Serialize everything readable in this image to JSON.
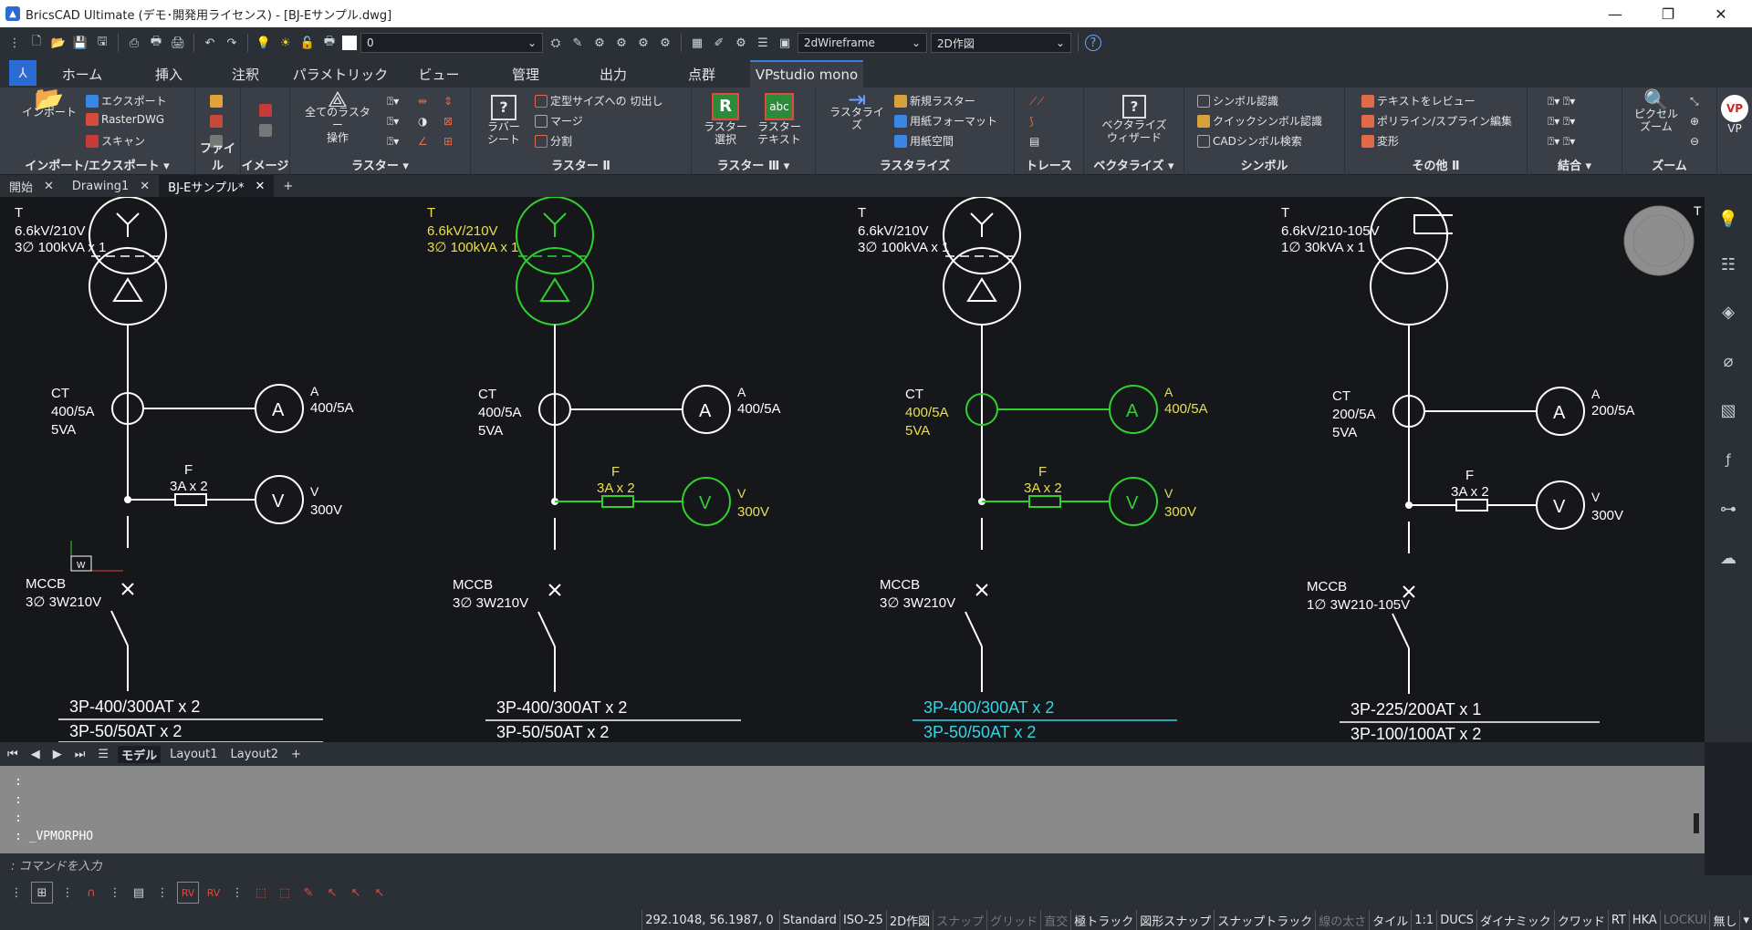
{
  "window": {
    "title": "BricsCAD Ultimate (デモ･開発用ライセンス) - [BJ-Eサンプル.dwg]",
    "app_icon": "bricscad-logo"
  },
  "qat": {
    "layer_value": "0",
    "visual_style": "2dWireframe",
    "workspace": "2D作図"
  },
  "ribbon_tabs": [
    {
      "label": "ホーム"
    },
    {
      "label": "挿入"
    },
    {
      "label": "注釈"
    },
    {
      "label": "パラメトリック"
    },
    {
      "label": "ビュー"
    },
    {
      "label": "管理"
    },
    {
      "label": "出力"
    },
    {
      "label": "点群"
    },
    {
      "label": "VPstudio mono"
    }
  ],
  "ribbon": {
    "import_export": {
      "import": "インポート",
      "export": "エクスポート",
      "rasterdwg": "RasterDWG",
      "scan": "スキャン",
      "title": "インポート/エクスポート"
    },
    "file": {
      "title": "ファイル"
    },
    "image": {
      "title": "イメージ"
    },
    "raster": {
      "all_ops": "全てのラスター\n操作",
      "title": "ラスター"
    },
    "raster2": {
      "rubber": "ラバー\nシート",
      "crop": "定型サイズへの 切出し",
      "merge": "マージ",
      "split": "分割",
      "title": "ラスター Ⅱ"
    },
    "raster3": {
      "select": "ラスター\n選択",
      "text": "ラスター\nテキスト",
      "title": "ラスター Ⅲ",
      "icon_r": "R",
      "icon_abc": "abc"
    },
    "rasterize": {
      "rasterize": "ラスタライズ",
      "new_raster": "新規ラスター",
      "paper_format": "用紙フォーマット",
      "paper_space": "用紙空間",
      "title": "ラスタライズ"
    },
    "trace": {
      "title": "トレース"
    },
    "vectorize": {
      "wizard": "ベクタライズ\nウィザード",
      "title": "ベクタライズ"
    },
    "symbol": {
      "recog": "シンボル認識",
      "quick": "クイックシンボル認識",
      "cad_search": "CADシンボル検索",
      "title": "シンボル"
    },
    "other2": {
      "review": "テキストをレビュー",
      "poly_edit": "ポリライン/スプライン編集",
      "deform": "変形",
      "title": "その他 Ⅱ"
    },
    "combine": {
      "title": "結合"
    },
    "zoom": {
      "pixel_zoom": "ピクセル\nズーム",
      "title": "ズーム"
    },
    "vp": {
      "label": "VP"
    }
  },
  "doc_tabs": [
    {
      "label": "開始"
    },
    {
      "label": "Drawing1"
    },
    {
      "label": "BJ-Eサンプル*"
    }
  ],
  "drawing": {
    "units": [
      {
        "t": "T",
        "tr1": "6.6kV/210V",
        "tr2": "3∅ 100kVA x 1",
        "ct": "CT",
        "ct1": "400/5A",
        "ct2": "5VA",
        "a": "A",
        "a1": "400/5A",
        "f": "F",
        "f1": "3A x 2",
        "v": "V",
        "v1": "300V",
        "mccb": "MCCB",
        "mccb1": "3∅ 3W210V",
        "b1": "3P-400/300AT x 2",
        "b2": "3P-50/50AT x 2"
      },
      {
        "t": "T",
        "tr1": "6.6kV/210V",
        "tr2": "3∅ 100kVA x 1",
        "ct": "CT",
        "ct1": "400/5A",
        "ct2": "5VA",
        "a": "A",
        "a1": "400/5A",
        "f": "F",
        "f1": "3A x 2",
        "v": "V",
        "v1": "300V",
        "mccb": "MCCB",
        "mccb1": "3∅ 3W210V",
        "b1": "3P-400/300AT x 2",
        "b2": "3P-50/50AT x 2"
      },
      {
        "t": "T",
        "tr1": "6.6kV/210V",
        "tr2": "3∅ 100kVA x 1",
        "ct": "CT",
        "ct1": "400/5A",
        "ct2": "5VA",
        "a": "A",
        "a1": "400/5A",
        "f": "F",
        "f1": "3A x 2",
        "v": "V",
        "v1": "300V",
        "mccb": "MCCB",
        "mccb1": "3∅ 3W210V",
        "b1": "3P-400/300AT x 2",
        "b2": "3P-50/50AT x 2"
      },
      {
        "t": "T",
        "tr1": "6.6kV/210-105V",
        "tr2": "1∅ 30kVA x 1",
        "ct": "CT",
        "ct1": "200/5A",
        "ct2": "5VA",
        "a": "A",
        "a1": "200/5A",
        "f": "F",
        "f1": "3A x 2",
        "v": "V",
        "v1": "300V",
        "mccb": "MCCB",
        "mccb1": "1∅ 3W210-105V",
        "b1": "3P-225/200AT x 1",
        "b2": "3P-100/100AT x 2"
      }
    ],
    "colors": {
      "white": "#ffffff",
      "green": "#2fd12f",
      "yellow": "#e8e04a",
      "cyan": "#33d6e6"
    },
    "ucs_label": "W",
    "edge_label": "T"
  },
  "layout_tabs": [
    {
      "label": "モデル"
    },
    {
      "label": "Layout1"
    },
    {
      "label": "Layout2"
    }
  ],
  "command": {
    "history": [
      ":",
      ":",
      ":",
      ": _VPMORPHO"
    ],
    "prompt": ": コマンドを入力"
  },
  "status": {
    "coords": "292.1048, 56.1987, 0",
    "items": [
      {
        "label": "Standard",
        "on": true
      },
      {
        "label": "ISO-25",
        "on": true
      },
      {
        "label": "2D作図",
        "on": true
      },
      {
        "label": "スナップ",
        "on": false
      },
      {
        "label": "グリッド",
        "on": false
      },
      {
        "label": "直交",
        "on": false
      },
      {
        "label": "極トラック",
        "on": true
      },
      {
        "label": "図形スナップ",
        "on": true
      },
      {
        "label": "スナップトラック",
        "on": true
      },
      {
        "label": "線の太さ",
        "on": false
      },
      {
        "label": "タイル",
        "on": true
      },
      {
        "label": "1:1",
        "on": true
      },
      {
        "label": "DUCS",
        "on": true
      },
      {
        "label": "ダイナミック",
        "on": true
      },
      {
        "label": "クワッド",
        "on": true
      },
      {
        "label": "RT",
        "on": true
      },
      {
        "label": "HKA",
        "on": true
      },
      {
        "label": "LOCKUI",
        "on": false
      },
      {
        "label": "無し",
        "on": true
      }
    ]
  }
}
